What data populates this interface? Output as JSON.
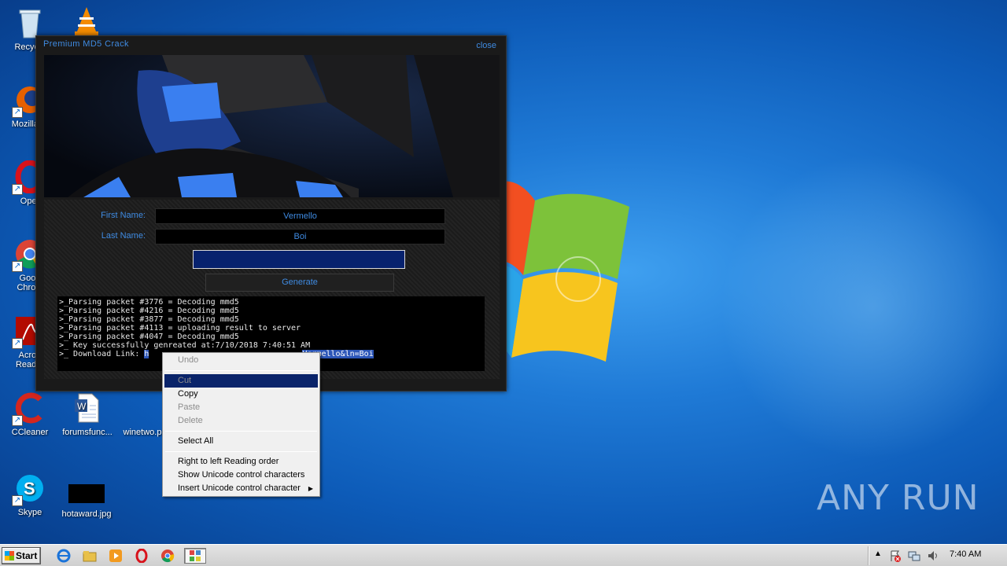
{
  "desktop": {
    "icons": [
      {
        "label": "Recycle Bin",
        "display": "Recycle"
      },
      {
        "label": "VLC",
        "display": ""
      },
      {
        "label": "Mozilla Firefox",
        "display": "Mozilla Fi"
      },
      {
        "label": "Opera",
        "display": "Oper"
      },
      {
        "label": "Google Chrome",
        "display": "Goog\nChrom"
      },
      {
        "label": "Acrobat Reader",
        "display": "Acrob\nReader"
      },
      {
        "label": "CCleaner",
        "display": "CCleaner"
      },
      {
        "label": "forumsfunc...",
        "display": "forumsfunc..."
      },
      {
        "label": "winetwo.p",
        "display": "winetwo.p"
      },
      {
        "label": "Skype",
        "display": "Skype"
      },
      {
        "label": "hotaward.jpg",
        "display": "hotaward.jpg"
      }
    ],
    "watermark": "ANY RUN"
  },
  "keygen": {
    "title": "Premium MD5  Crack",
    "close": "close",
    "first_name_label": "First Name:",
    "first_name_value": "Vermello",
    "last_name_label": "Last Name:",
    "last_name_value": "Boi",
    "key_value": "",
    "generate_label": "Generate",
    "log_lines": [
      ">_Parsing packet #3776 = Decoding mmd5",
      ">_Parsing packet #4216 = Decoding mmd5",
      ">_Parsing packet #3877 = Decoding mmd5",
      ">_Parsing packet #4113 = uploading result to server",
      ">_Parsing packet #4047 = Decoding mmd5",
      ">_ Key successfully genreated at:7/10/2018 7:40:51 AM"
    ],
    "download_prefix": ">_ Download Link: ",
    "download_selected_head": "h",
    "download_selected_tail": "Vermello&ln=Boi"
  },
  "context_menu": {
    "undo": "Undo",
    "cut": "Cut",
    "copy": "Copy",
    "paste": "Paste",
    "delete": "Delete",
    "select_all": "Select All",
    "rtl": "Right to left Reading order",
    "show_unicode": "Show Unicode control characters",
    "insert_unicode": "Insert Unicode control character"
  },
  "taskbar": {
    "start_label": "Start",
    "clock": "7:40 AM",
    "items": [
      "internet-explorer",
      "file-explorer",
      "media-player",
      "opera",
      "chrome",
      "keygen-app"
    ]
  },
  "colors": {
    "accent": "#3f8be2",
    "menu_highlight": "#0a246a",
    "key_box": "#07226e"
  }
}
